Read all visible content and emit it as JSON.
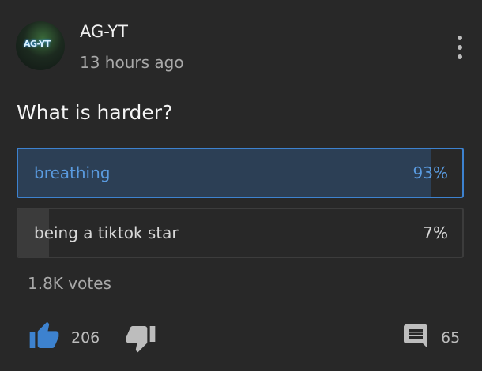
{
  "post": {
    "author": "AG-YT",
    "avatar_text": "AG-YT",
    "time": "13 hours ago",
    "question": "What is harder?"
  },
  "poll": {
    "options": [
      {
        "label": "breathing",
        "percent_label": "93%",
        "percent": 93,
        "selected": true
      },
      {
        "label": "being a tiktok star",
        "percent_label": "7%",
        "percent": 7,
        "selected": false
      }
    ],
    "votes": "1.8K votes"
  },
  "actions": {
    "like_count": "206",
    "comment_count": "65",
    "icons": {
      "like": "thumbs-up-icon",
      "dislike": "thumbs-down-icon",
      "comment": "comment-icon",
      "menu": "more-vert-icon"
    }
  },
  "colors": {
    "background": "#282828",
    "accent": "#3d82cf",
    "selected_fill": "#2c3f55",
    "unselected_fill": "#3b3b3b"
  }
}
